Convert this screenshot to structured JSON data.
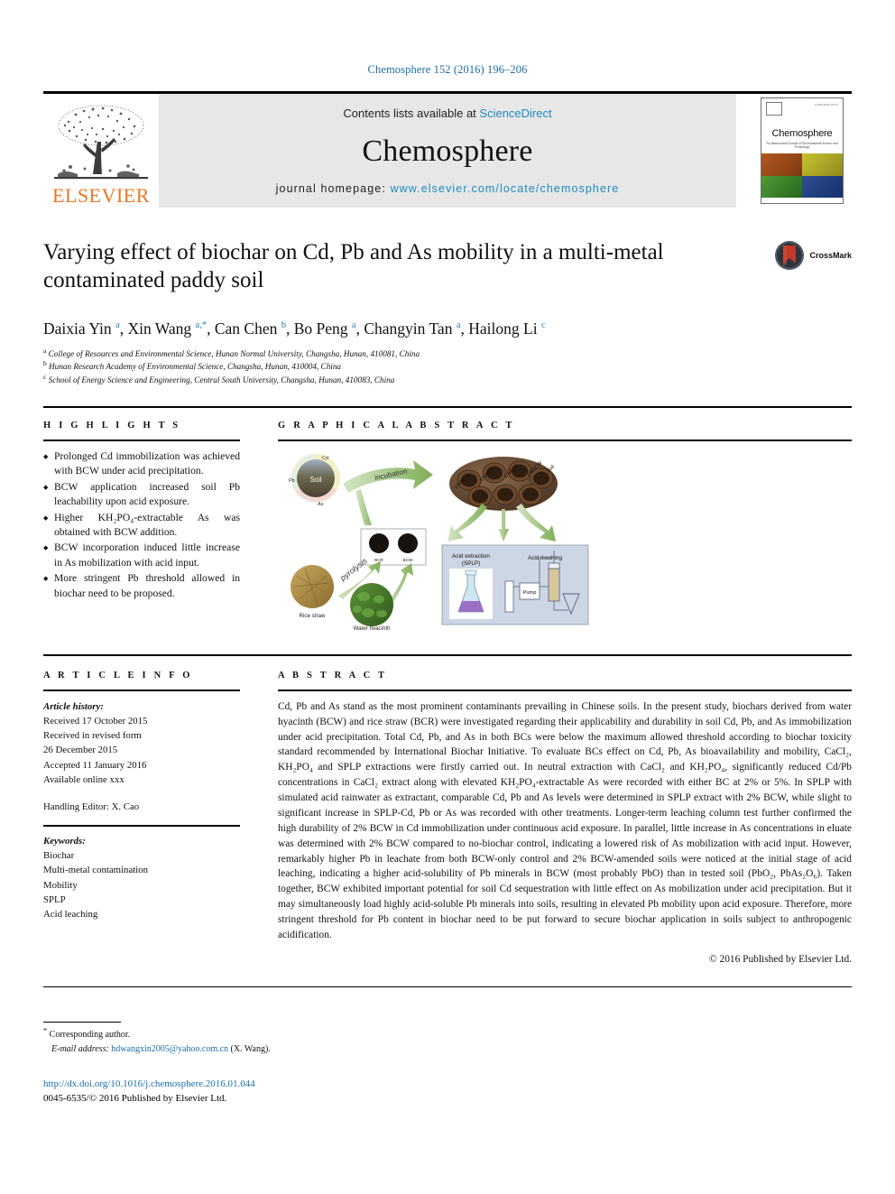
{
  "running_head": "Chemosphere 152 (2016) 196–206",
  "masthead": {
    "publisher": "ELSEVIER",
    "contents_prefix": "Contents lists available at ",
    "contents_link": "ScienceDirect",
    "journal_name": "Chemosphere",
    "homepage_prefix": "journal homepage: ",
    "homepage_url": "www.elsevier.com/locate/chemosphere",
    "cover": {
      "title": "Chemosphere",
      "subtitle": "An International Journal of Environmental Science and Technology",
      "issn": "ISSN 0045-6535",
      "quad_colors": [
        "#9d4a18",
        "#b5ae2d",
        "#3f8a2d",
        "#23407f"
      ]
    }
  },
  "article": {
    "title": "Varying effect of biochar on Cd, Pb and As mobility in a multi-metal contaminated paddy soil",
    "crossmark_label": "CrossMark",
    "authors_html": "Daixia Yin <sup>a</sup>, Xin Wang <sup>a,&#42;</sup>, Can Chen <sup>b</sup>, Bo Peng <sup>a</sup>, Changyin Tan <sup>a</sup>, Hailong Li <sup>c</sup>",
    "affiliations": [
      {
        "marker": "a",
        "text": "College of Resources and Environmental Science, Hunan Normal University, Changsha, Hunan, 410081, China"
      },
      {
        "marker": "b",
        "text": "Hunan Research Academy of Environmental Science, Changsha, Hunan, 410004, China"
      },
      {
        "marker": "c",
        "text": "School of Energy Science and Engineering, Central South University, Changsha, Hunan, 410083, China"
      }
    ]
  },
  "highlights": {
    "heading": "H I G H L I G H T S",
    "items": [
      "Prolonged Cd immobilization was achieved with BCW under acid precipitation.",
      "BCW application increased soil Pb leachability upon acid exposure.",
      "Higher KH₂PO₄-extractable As was obtained with BCW addition.",
      "BCW incorporation induced little increase in As mobilization with acid input.",
      "More stringent Pb threshold allowed in biochar need to be proposed."
    ]
  },
  "graphical_abstract": {
    "heading": "G R A P H I C A L  A B S T R A C T",
    "labels": {
      "soil": "Soil",
      "cd": "Cd",
      "pb": "Pb",
      "as": "As",
      "incubation": "incubation",
      "pyrolysis": "pyrolysis",
      "rice_straw": "Rice straw",
      "water_hyacinth": "Water hyacinth",
      "bcr": "BCR",
      "bcw": "BCW",
      "pot_labels": [
        "5%BCW",
        "5%BCR",
        "2%BCR",
        "2%BCW",
        "Soil"
      ],
      "acid_extraction": "Acid extraction (SPLP)",
      "acid_leaching": "Acid leaching",
      "pump": "Pump"
    }
  },
  "article_info": {
    "heading": "A R T I C L E  I N F O",
    "history_label": "Article history:",
    "history": [
      "Received 17 October 2015",
      "Received in revised form",
      "26 December 2015",
      "Accepted 11 January 2016",
      "Available online xxx"
    ],
    "handling_editor": "Handling Editor: X. Cao",
    "keywords_label": "Keywords:",
    "keywords": [
      "Biochar",
      "Multi-metal contamination",
      "Mobility",
      "SPLP",
      "Acid leaching"
    ]
  },
  "abstract": {
    "heading": "A B S T R A C T",
    "text": "Cd, Pb and As stand as the most prominent contaminants prevailing in Chinese soils. In the present study, biochars derived from water hyacinth (BCW) and rice straw (BCR) were investigated regarding their applicability and durability in soil Cd, Pb, and As immobilization under acid precipitation. Total Cd, Pb, and As in both BCs were below the maximum allowed threshold according to biochar toxicity standard recommended by International Biochar Initiative. To evaluate BCs effect on Cd, Pb, As bioavailability and mobility, CaCl₂, KH₂PO₄ and SPLP extractions were firstly carried out. In neutral extraction with CaCl₂ and KH₂PO₄, significantly reduced Cd/Pb concentrations in CaCl₂ extract along with elevated KH₂PO₄-extractable As were recorded with either BC at 2% or 5%. In SPLP with simulated acid rainwater as extractant, comparable Cd, Pb and As levels were determined in SPLP extract with 2% BCW, while slight to significant increase in SPLP-Cd, Pb or As was recorded with other treatments. Longer-term leaching column test further confirmed the high durability of 2% BCW in Cd immobilization under continuous acid exposure. In parallel, little increase in As concentrations in eluate was determined with 2% BCW compared to no-biochar control, indicating a lowered risk of As mobilization with acid input. However, remarkably higher Pb in leachate from both BCW-only control and 2% BCW-amended soils were noticed at the initial stage of acid leaching, indicating a higher acid-solubility of Pb minerals in BCW (most probably PbO) than in tested soil (PbO₂, PbAs₂O₆). Taken together, BCW exhibited important potential for soil Cd sequestration with little effect on As mobilization under acid precipitation. But it may simultaneously load highly acid-soluble Pb minerals into soils, resulting in elevated Pb mobility upon acid exposure. Therefore, more stringent threshold for Pb content in biochar need to be put forward to secure biochar application in soils subject to anthropogenic acidification.",
    "copyright": "© 2016 Published by Elsevier Ltd."
  },
  "footer": {
    "corresponding_author": "Corresponding author.",
    "email_label": "E-mail address:",
    "email": "hdwangxin2005@yahoo.com.cn",
    "email_owner": "(X. Wang).",
    "doi": "http://dx.doi.org/10.1016/j.chemosphere.2016.01.044",
    "issn_line": "0045-6535/© 2016 Published by Elsevier Ltd."
  }
}
